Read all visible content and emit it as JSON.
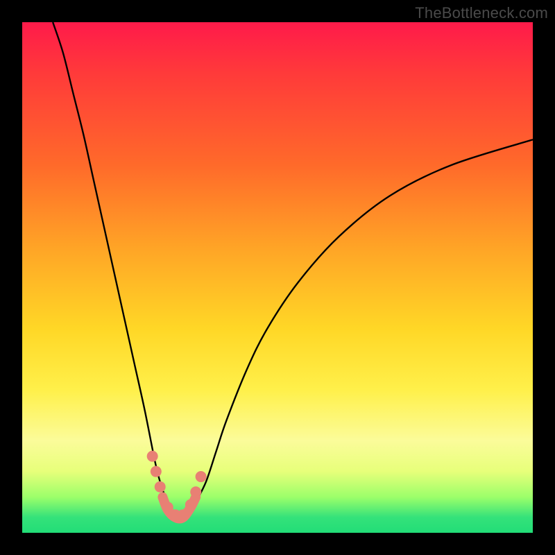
{
  "watermark": "TheBottleneck.com",
  "colors": {
    "frame": "#000000",
    "gradient_top": "#ff1a4a",
    "gradient_mid1": "#ff6a2a",
    "gradient_mid2": "#ffd726",
    "gradient_mid3": "#fff04a",
    "gradient_bottom": "#22dd77",
    "curve": "#000000",
    "marker": "#e88074"
  },
  "chart_data": {
    "type": "line",
    "title": "",
    "xlabel": "",
    "ylabel": "",
    "xlim": [
      0,
      100
    ],
    "ylim": [
      0,
      100
    ],
    "series": [
      {
        "name": "bottleneck-curve",
        "x": [
          6,
          8,
          10,
          12,
          14,
          16,
          18,
          20,
          22,
          24,
          26,
          27,
          28,
          29,
          30,
          31,
          32,
          33,
          34,
          36,
          38,
          40,
          44,
          48,
          54,
          62,
          72,
          84,
          100
        ],
        "values": [
          100,
          94,
          86,
          78,
          69,
          60,
          51,
          42,
          33,
          24,
          14,
          10,
          7,
          4,
          3,
          3,
          3,
          4,
          6,
          10,
          16,
          22,
          32,
          40,
          49,
          58,
          66,
          72,
          77
        ]
      }
    ],
    "markers": {
      "name": "highlight-dots",
      "x": [
        25.5,
        26.2,
        27.0,
        28.5,
        30.0,
        31.5,
        33.0,
        34.0,
        35.0
      ],
      "values": [
        15.0,
        12.0,
        9.0,
        5.0,
        3.5,
        3.5,
        5.5,
        8.0,
        11.0
      ]
    },
    "valley_band": {
      "x": [
        27.5,
        28.5,
        30.0,
        31.5,
        33.0,
        34.0
      ],
      "values": [
        7.0,
        4.5,
        3.0,
        3.0,
        5.0,
        7.0
      ]
    }
  }
}
